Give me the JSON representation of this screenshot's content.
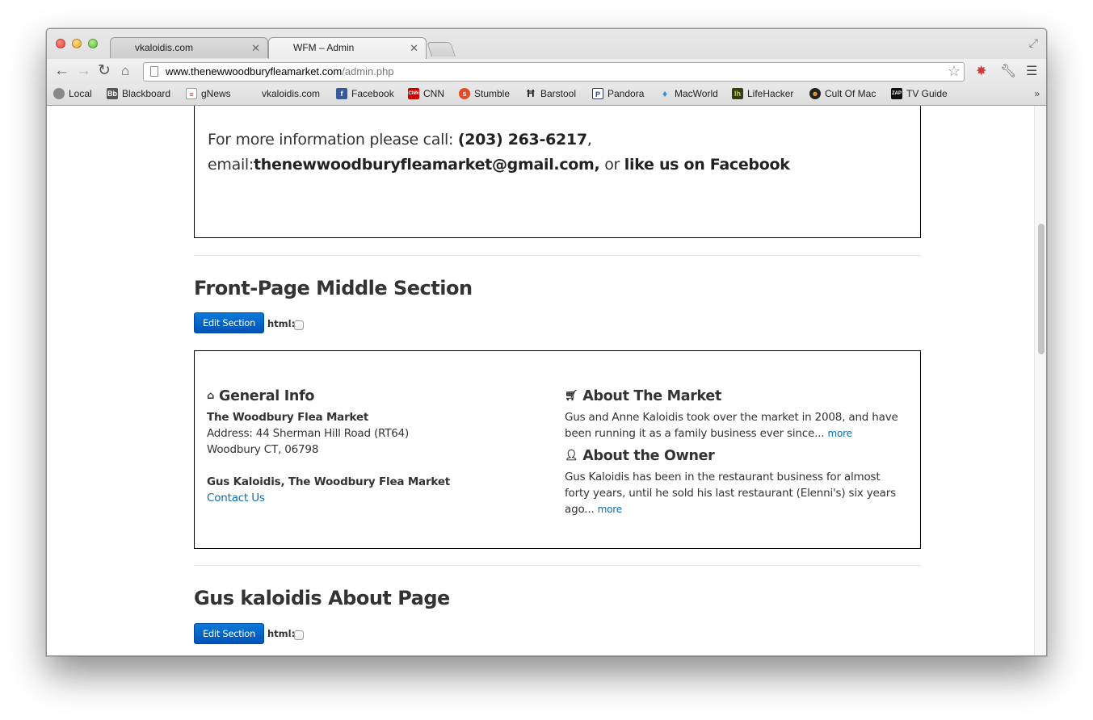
{
  "browser": {
    "tabs": [
      {
        "title": "vkaloidis.com"
      },
      {
        "title": "WFM – Admin"
      }
    ],
    "url_host": "www.thenewwoodburyfleamarket.com",
    "url_path": "/admin.php",
    "bookmarks": [
      {
        "label": "Local",
        "icon": "globe-icon"
      },
      {
        "label": "Blackboard",
        "icon": "blackboard-icon"
      },
      {
        "label": "gNews",
        "icon": "news-icon"
      },
      {
        "label": "vkaloidis.com",
        "icon": "blank-icon"
      },
      {
        "label": "Facebook",
        "icon": "facebook-icon"
      },
      {
        "label": "CNN",
        "icon": "cnn-icon"
      },
      {
        "label": "Stumble",
        "icon": "stumble-icon"
      },
      {
        "label": "Barstool",
        "icon": "barstool-icon"
      },
      {
        "label": "Pandora",
        "icon": "pandora-icon"
      },
      {
        "label": "MacWorld",
        "icon": "macworld-icon"
      },
      {
        "label": "LifeHacker",
        "icon": "lifehacker-icon"
      },
      {
        "label": "Cult Of Mac",
        "icon": "cultofmac-icon"
      },
      {
        "label": "TV Guide",
        "icon": "tvguide-icon"
      }
    ],
    "more_bookmarks": "»"
  },
  "top_box": {
    "line1_prefix": "For more information please call: ",
    "phone": "(203) 263-6217",
    "line1_suffix": ",",
    "email_prefix": "email:",
    "email": "thenewwoodburyfleamarket@gmail.com,",
    "or_text": " or ",
    "facebook_text": "like us on Facebook"
  },
  "middle_section": {
    "title": "Front-Page Middle Section",
    "edit_label": "Edit Section",
    "html_label": "html:",
    "general": {
      "heading": "General Info",
      "name": "The Woodbury Flea Market",
      "address1": "Address: 44 Sherman Hill Road (RT64)",
      "address2": "Woodbury CT, 06798",
      "owner_line": "Gus Kaloidis, The Woodbury Flea Market",
      "contact_link": "Contact Us"
    },
    "market": {
      "heading": "About The Market",
      "text": "Gus and Anne Kaloidis took over the market in 2008, and have been running it as a family business ever since...",
      "more": "more"
    },
    "owner": {
      "heading": "About the Owner",
      "text": "Gus Kaloidis has been in the restaurant business for almost forty years, until he sold his last restaurant (Elenni's) six years ago...",
      "more": "more"
    }
  },
  "about_section": {
    "title": "Gus kaloidis About Page",
    "edit_label": "Edit Section",
    "html_label": "html:"
  }
}
